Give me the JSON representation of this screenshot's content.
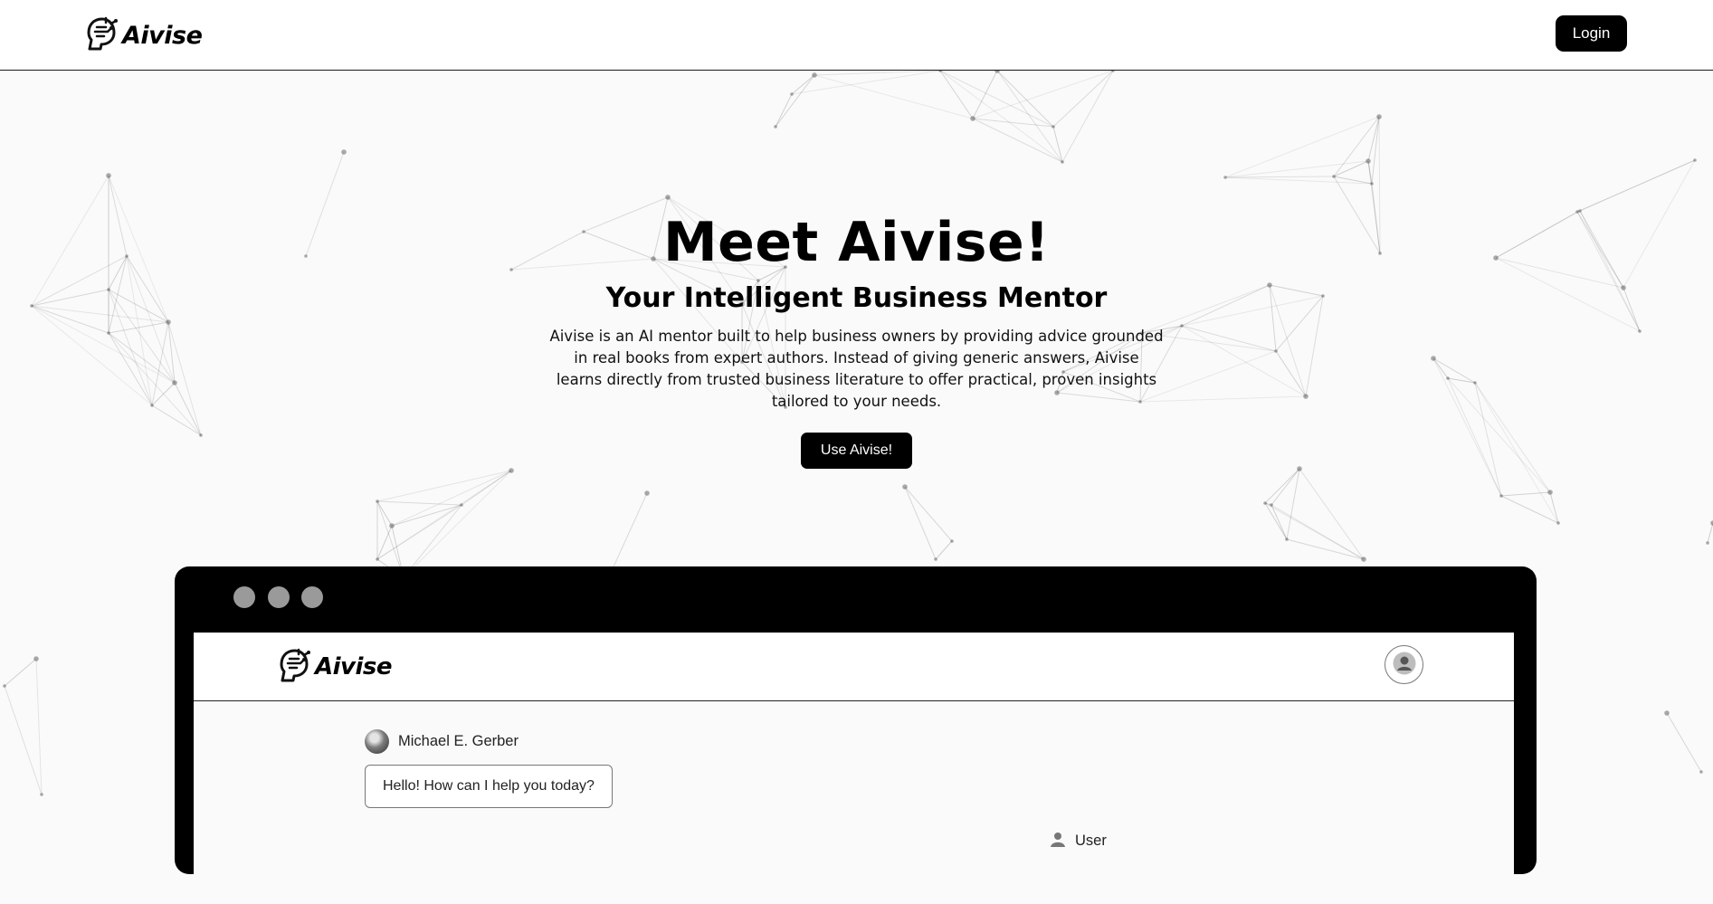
{
  "topnav": {
    "brand": "Aivise",
    "login_label": "Login"
  },
  "hero": {
    "title": "Meet Aivise!",
    "subtitle": "Your Intelligent Business Mentor",
    "description": "Aivise is an AI mentor built to help business owners by providing advice grounded in real books from expert authors. Instead of giving generic answers, Aivise learns directly from trusted business literature to offer practical, proven insights tailored to your needs.",
    "cta_label": "Use Aivise!"
  },
  "preview": {
    "brand": "Aivise",
    "messages": [
      {
        "sender": "Michael E. Gerber",
        "text": "Hello! How can I help you today?"
      },
      {
        "sender": "User"
      }
    ]
  },
  "colors": {
    "accent": "#000000",
    "window_dots": "#9a9a9a",
    "background": "#fafafa"
  }
}
